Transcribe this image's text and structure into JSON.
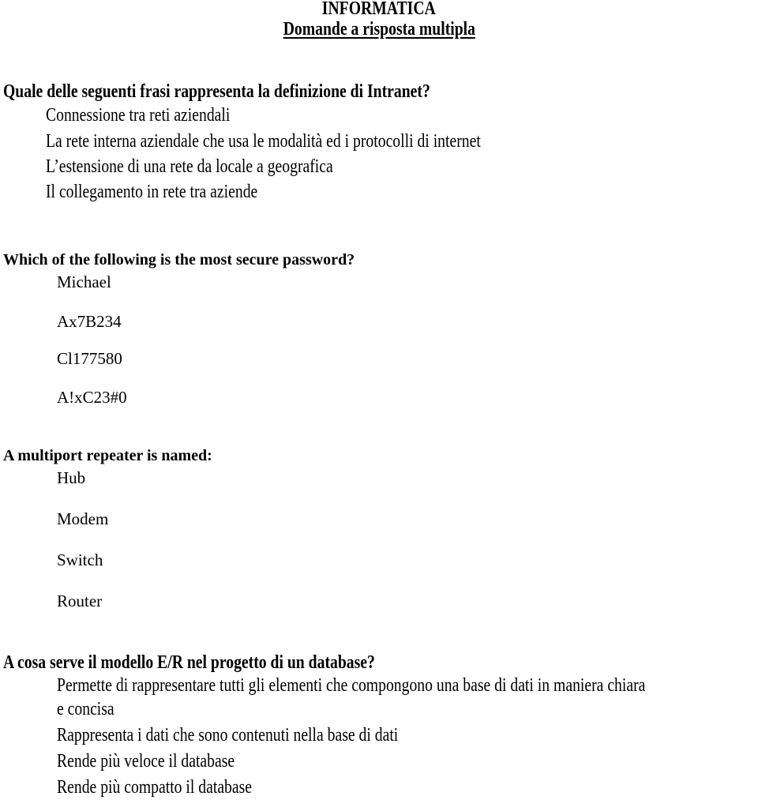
{
  "header": {
    "title": "INFORMATICA",
    "subtitle": "Domande a risposta multipla"
  },
  "questions": [
    {
      "text": "Quale delle seguenti frasi rappresenta la definizione di Intranet?",
      "options": [
        "Connessione tra reti aziendali",
        "La rete interna aziendale che usa le modalità ed i protocolli di internet",
        "L’estensione di una rete da locale a geografica",
        "Il collegamento in rete tra aziende"
      ]
    },
    {
      "text": "Which of  the following is the most secure password?",
      "options": [
        "Michael",
        "Ax7B234",
        "Cl177580",
        "A!xC23#0"
      ]
    },
    {
      "text": "A multiport repeater is named:",
      "options": [
        "Hub",
        "Modem",
        "Switch",
        "Router"
      ]
    },
    {
      "text": "A cosa serve il modello E/R nel progetto di un database?",
      "options": [
        "Permette di rappresentare tutti gli elementi che compongono una base di dati in maniera chiara",
        "e concisa",
        "Rappresenta i dati che sono contenuti nella base di dati",
        "Rende più veloce il database",
        "Rende più compatto il database"
      ]
    }
  ]
}
